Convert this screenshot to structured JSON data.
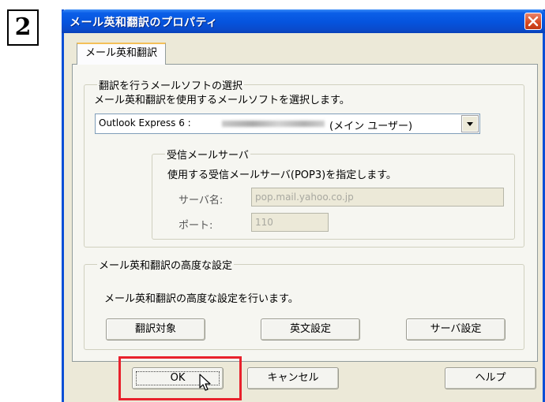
{
  "step_number": "2",
  "dialog": {
    "title": "メール英和翻訳のプロパティ",
    "tab_label": "メール英和翻訳"
  },
  "mail_software": {
    "legend": "翻訳を行うメールソフトの選択",
    "description": "メール英和翻訳を使用するメールソフトを選択します。",
    "selected_prefix": "Outlook Express 6 :",
    "selected_suffix": "(メイン ユーザー)"
  },
  "receive_server": {
    "legend": "受信メールサーバ",
    "description": "使用する受信メールサーバ(POP3)を指定します。",
    "server_label": "サーバ名:",
    "server_value": "pop.mail.yahoo.co.jp",
    "port_label": "ポート:",
    "port_value": "110"
  },
  "advanced": {
    "legend": "メール英和翻訳の高度な設定",
    "description": "メール英和翻訳の高度な設定を行います。",
    "buttons": [
      "翻訳対象",
      "英文設定",
      "サーバ設定"
    ]
  },
  "footer": {
    "ok": "OK",
    "cancel": "キャンセル",
    "help": "ヘルプ"
  },
  "icons": {
    "close": "close-icon",
    "dropdown": "chevron-down-icon",
    "cursor": "mouse-pointer-icon"
  },
  "colors": {
    "titlebar": "#0553dd",
    "dialog_bg": "#ece9d8",
    "highlight": "#e8212c",
    "close_button": "#d6481f"
  }
}
